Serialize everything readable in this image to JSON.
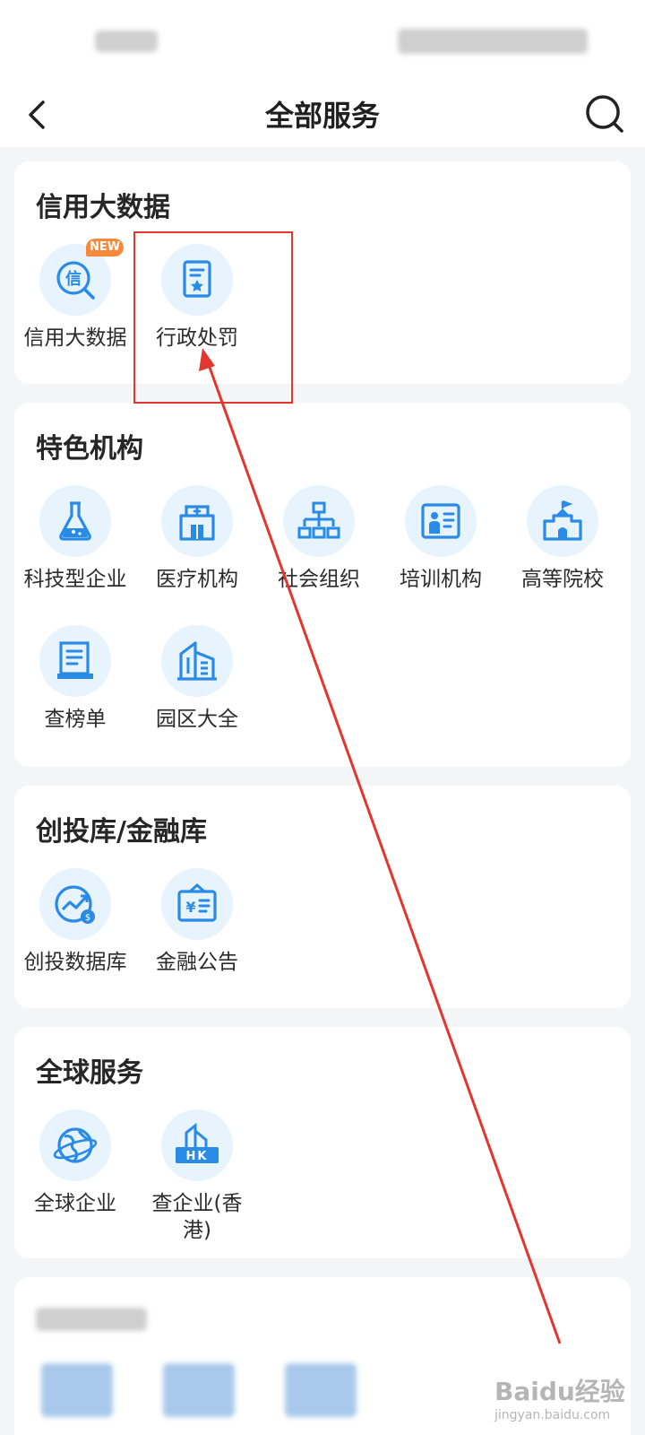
{
  "header": {
    "title": "全部服务"
  },
  "sections": [
    {
      "title": "信用大数据",
      "items": [
        {
          "label": "信用大数据",
          "icon": "credit-search-icon",
          "badge": "NEW"
        },
        {
          "label": "行政处罚",
          "icon": "document-star-icon"
        }
      ]
    },
    {
      "title": "特色机构",
      "items": [
        {
          "label": "科技型企业",
          "icon": "flask-icon"
        },
        {
          "label": "医疗机构",
          "icon": "hospital-icon"
        },
        {
          "label": "社会组织",
          "icon": "org-chart-icon"
        },
        {
          "label": "培训机构",
          "icon": "training-board-icon"
        },
        {
          "label": "高等院校",
          "icon": "university-icon"
        },
        {
          "label": "查榜单",
          "icon": "book-list-icon"
        },
        {
          "label": "园区大全",
          "icon": "buildings-icon"
        }
      ]
    },
    {
      "title": "创投库/金融库",
      "items": [
        {
          "label": "创投数据库",
          "icon": "growth-chart-icon"
        },
        {
          "label": "金融公告",
          "icon": "finance-notice-icon"
        }
      ]
    },
    {
      "title": "全球服务",
      "items": [
        {
          "label": "全球企业",
          "icon": "globe-icon"
        },
        {
          "label": "查企业(香港)",
          "label_line1": "查企业(香",
          "label_line2": "港)",
          "icon": "hk-building-icon"
        }
      ]
    }
  ],
  "watermark": {
    "brand": "Baidu经验",
    "sub": "jingyan.baidu.com"
  },
  "colors": {
    "accent": "#2a8be6",
    "icon_bg": "#e7f3fd",
    "badge": "#f6893a",
    "annotation": "#e2362f"
  }
}
